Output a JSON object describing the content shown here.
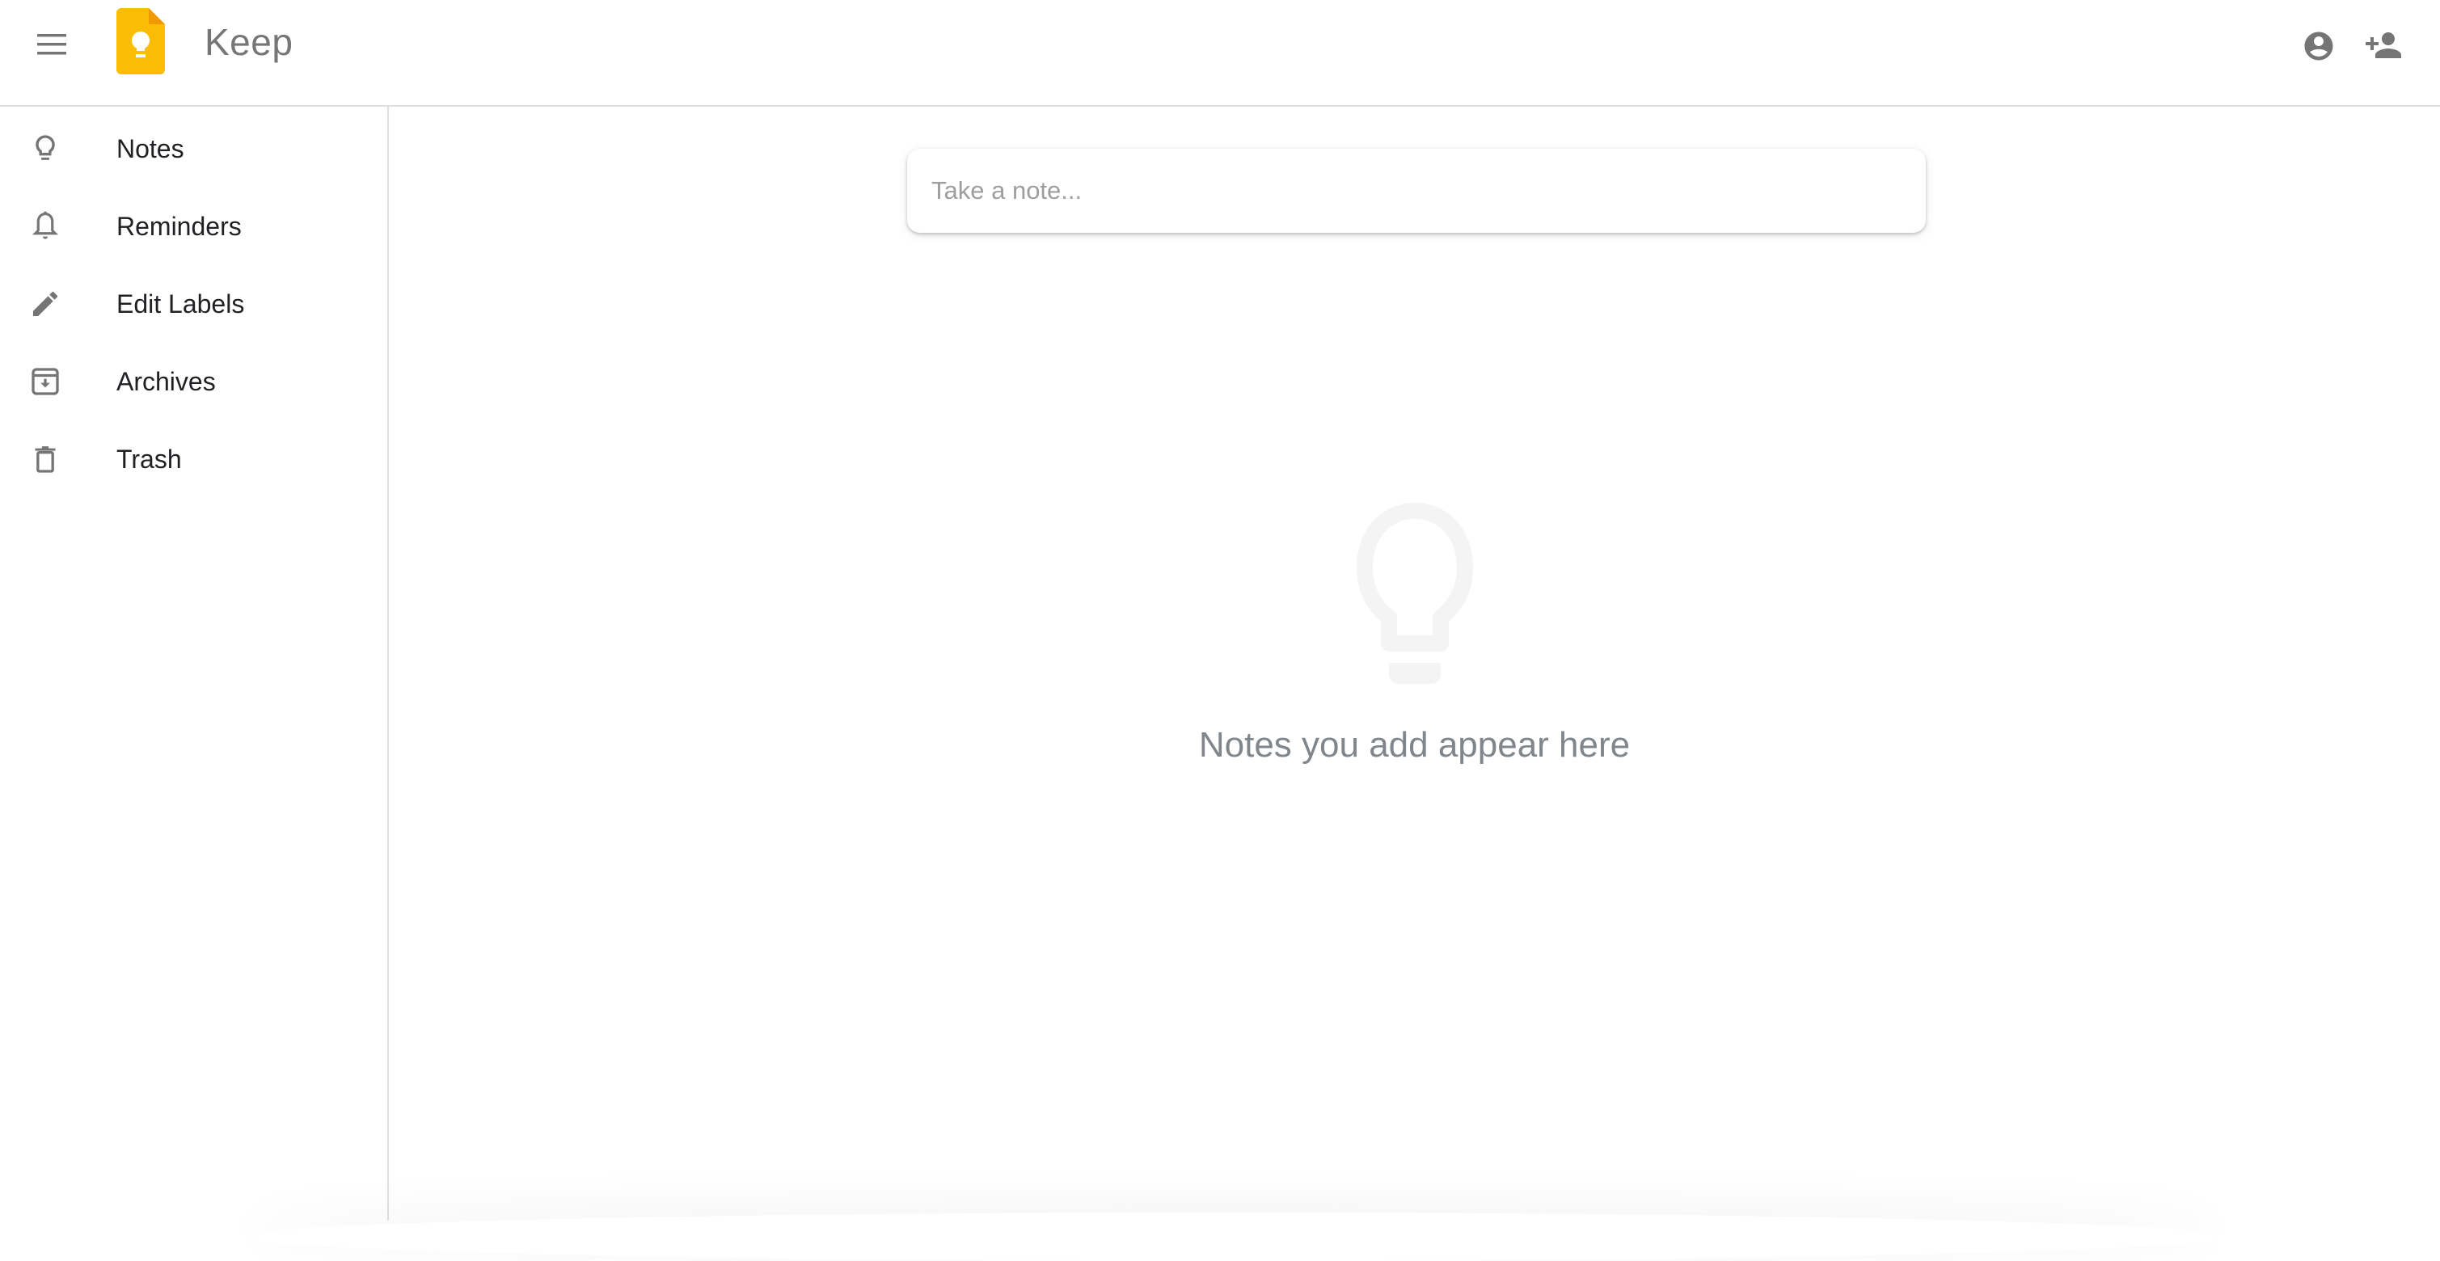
{
  "app": {
    "title": "Keep",
    "brand_colors": {
      "logo_primary": "#FBBC04",
      "logo_fold": "#F29900",
      "icon_gray": "#757575"
    }
  },
  "header": {
    "menu_icon": "hamburger-menu-icon",
    "logo_icon": "keep-logo-icon",
    "title": "Keep",
    "right_icons": [
      "account-circle-icon",
      "person-add-icon"
    ]
  },
  "sidebar": {
    "items": [
      {
        "label": "Notes",
        "icon": "lightbulb-icon"
      },
      {
        "label": "Reminders",
        "icon": "bell-icon"
      },
      {
        "label": "Edit Labels",
        "icon": "pencil-icon"
      },
      {
        "label": "Archives",
        "icon": "archive-icon"
      },
      {
        "label": "Trash",
        "icon": "trash-icon"
      }
    ]
  },
  "main": {
    "note_input": {
      "placeholder": "Take a note...",
      "value": ""
    },
    "empty_state": {
      "icon": "lightbulb-icon",
      "text": "Notes you add appear here"
    }
  }
}
